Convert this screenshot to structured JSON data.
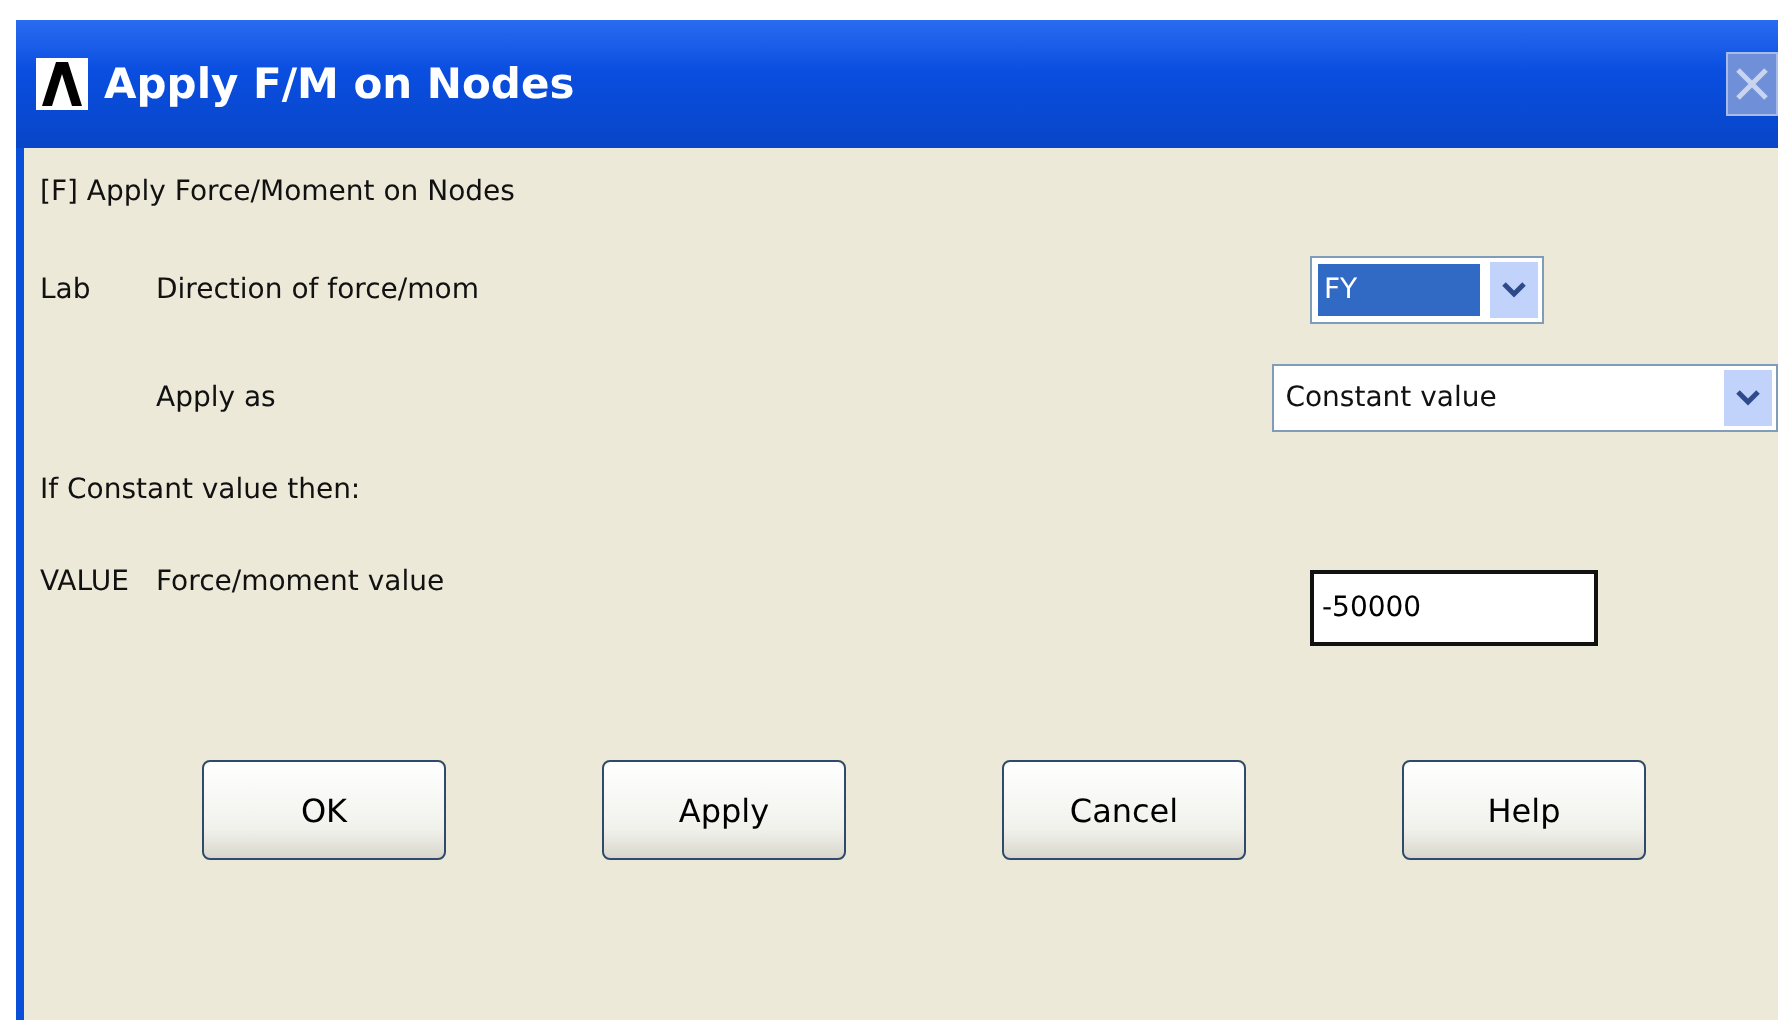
{
  "window": {
    "title": "Apply F/M on Nodes"
  },
  "header": "[F]  Apply Force/Moment on Nodes",
  "rows": [
    {
      "kind": "dropdown",
      "code": "Lab",
      "label": "Direction of force/mom",
      "value": "FY",
      "focused": true,
      "wide": false
    },
    {
      "kind": "dropdown",
      "label": "Apply as",
      "value": "Constant value",
      "focused": false,
      "wide": true
    },
    {
      "kind": "note",
      "label": "If Constant value then:"
    },
    {
      "kind": "field",
      "code": "VALUE",
      "label": "Force/moment value",
      "value": "-50000"
    }
  ],
  "buttons": [
    "OK",
    "Apply",
    "Cancel",
    "Help"
  ]
}
